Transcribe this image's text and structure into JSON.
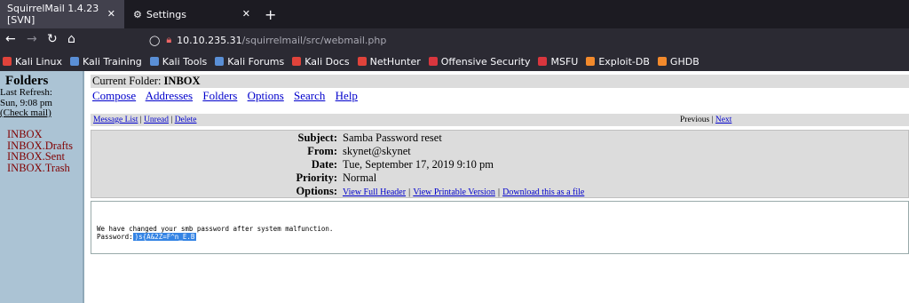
{
  "browser": {
    "tabs": [
      {
        "title": "SquirrelMail 1.4.23 [SVN]",
        "active": true
      },
      {
        "title": "Settings",
        "active": false
      }
    ],
    "url": {
      "host": "10.10.235.31",
      "path": "/squirrelmail/src/webmail.php"
    },
    "bookmarks": [
      {
        "label": "Kali Linux",
        "color": "#e0433b"
      },
      {
        "label": "Kali Training",
        "color": "#5a8fd6"
      },
      {
        "label": "Kali Tools",
        "color": "#5a8fd6"
      },
      {
        "label": "Kali Forums",
        "color": "#5a8fd6"
      },
      {
        "label": "Kali Docs",
        "color": "#e0433b"
      },
      {
        "label": "NetHunter",
        "color": "#e0433b"
      },
      {
        "label": "Offensive Security",
        "color": "#d9363e"
      },
      {
        "label": "MSFU",
        "color": "#d9363e"
      },
      {
        "label": "Exploit-DB",
        "color": "#f38a2c"
      },
      {
        "label": "GHDB",
        "color": "#f38a2c"
      }
    ]
  },
  "left": {
    "title": "Folders",
    "refresh_label": "Last Refresh:",
    "refresh_time": "Sun, 9:08 pm",
    "check_mail": "(Check mail)",
    "folders": [
      "INBOX",
      "INBOX.Drafts",
      "INBOX.Sent",
      "INBOX.Trash"
    ]
  },
  "main": {
    "current_folder_label": "Current Folder:",
    "current_folder": "INBOX",
    "nav": [
      "Compose",
      "Addresses",
      "Folders",
      "Options",
      "Search",
      "Help"
    ],
    "msgbar": {
      "message_list": "Message List",
      "unread": "Unread",
      "delete": "Delete",
      "previous": "Previous",
      "next": "Next",
      "sep": "|"
    },
    "headers": {
      "subject_label": "Subject:",
      "subject": "Samba Password reset",
      "from_label": "From:",
      "from": "skynet@skynet",
      "date_label": "Date:",
      "date": "Tue, September 17, 2019 9:10 pm",
      "priority_label": "Priority:",
      "priority": "Normal",
      "options_label": "Options:",
      "opt_full_header": "View Full Header",
      "opt_printable": "View Printable Version",
      "opt_download": "Download this as a file"
    },
    "body": {
      "line1": "We have changed your smb password after system malfunction.",
      "password_label": "Password:",
      "password": ")s{A&2Z=F^n_E.B"
    }
  }
}
